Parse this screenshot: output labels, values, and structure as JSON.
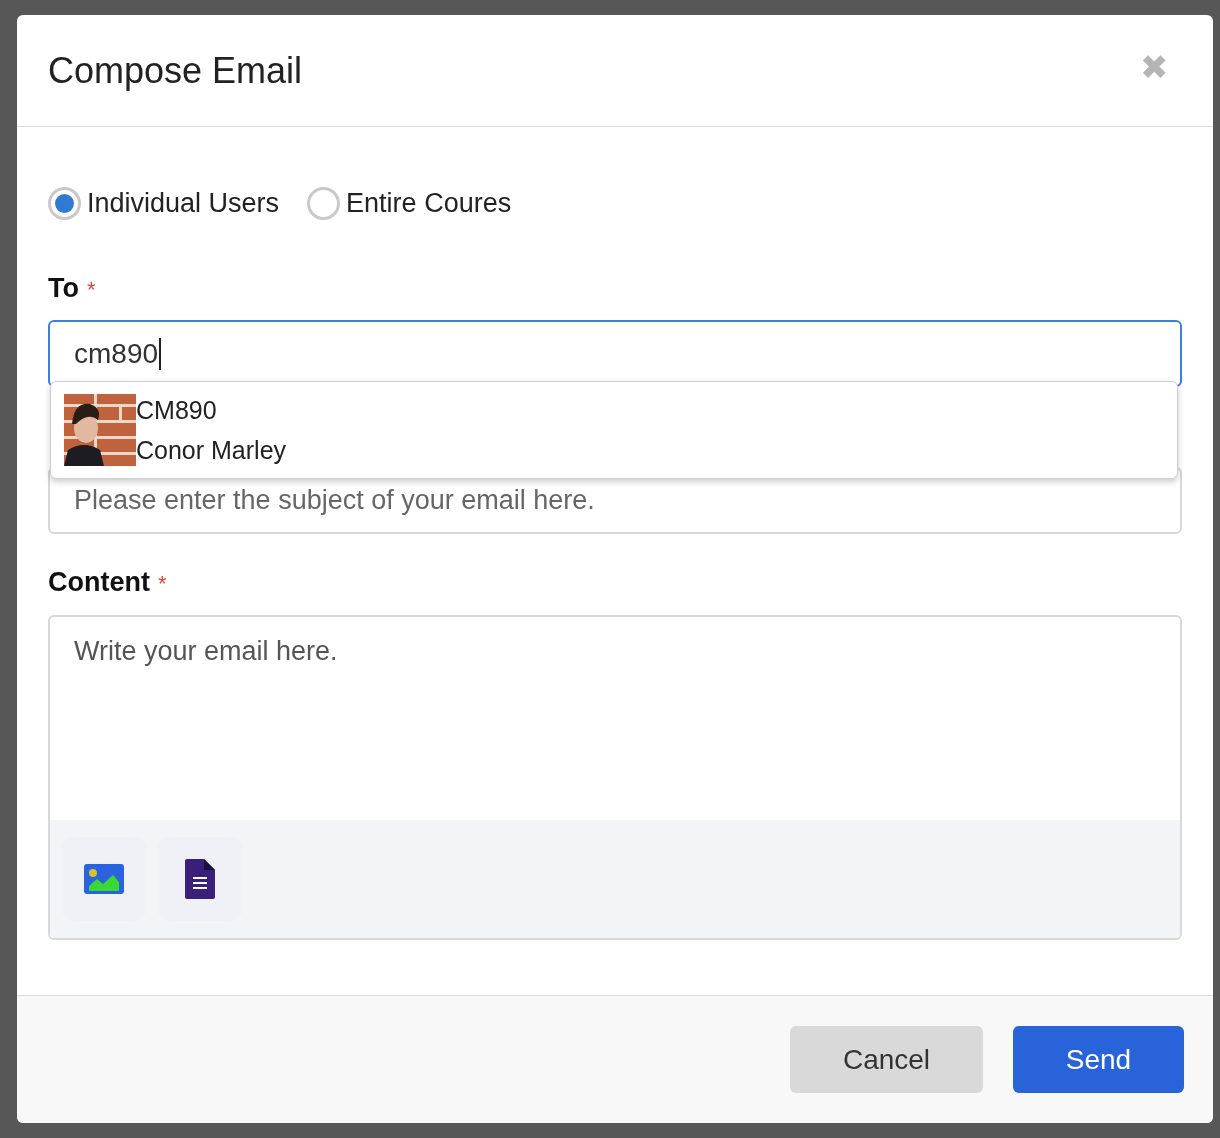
{
  "dialog": {
    "title": "Compose Email",
    "close_label": "✖"
  },
  "recipient_mode": [
    {
      "label": "Individual Users",
      "selected": true
    },
    {
      "label": "Entire Coures",
      "selected": false
    }
  ],
  "to": {
    "label": "To",
    "required_mark": "*",
    "value": "cm890"
  },
  "suggestions": [
    {
      "kind": "picture",
      "username": "CM890",
      "name": "Conor Marley"
    }
  ],
  "subject": {
    "placeholder": "Please enter the subject of your email here."
  },
  "content": {
    "label": "Content",
    "required_mark": "*",
    "placeholder": "Write your email here."
  },
  "buttons": [
    {
      "label": "Cancel",
      "kind": "secondary"
    },
    {
      "label": "Send",
      "kind": "primary"
    }
  ]
}
